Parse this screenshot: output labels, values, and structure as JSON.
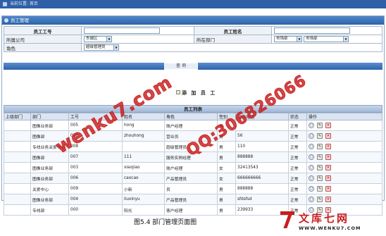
{
  "topbar": {
    "location": "当前位置: 首页"
  },
  "panel": {
    "title": "员工管理"
  },
  "form": {
    "emp_no_label": "员工工号",
    "emp_name_label": "员工姓名",
    "company_label": "所属公司",
    "company_value": "东城区",
    "dept_label": "所在部门",
    "dept_value1": "市场部",
    "dept_value2": "市场部",
    "role_label": "角色",
    "role_value": "超级管理员"
  },
  "search_button": "查  询",
  "add_employee": "添 加 员 工",
  "list_title": "员工列表",
  "table": {
    "headers": [
      "上级部门",
      "部门",
      "工号",
      "姓名",
      "角色",
      "性别",
      "工作电话",
      "状态",
      "操作"
    ],
    "rows": [
      [
        "",
        "图像业务部",
        "005",
        "hong",
        "账户经理",
        "男",
        "",
        "正常"
      ],
      [
        "",
        "图像部",
        "002",
        "zhouhong",
        "营业员",
        "男",
        "56",
        "正常"
      ],
      [
        "",
        "专线业务关爱中心",
        "008",
        "",
        "超级管理员",
        "男",
        "110",
        "正常"
      ],
      [
        "",
        "图像部",
        "007",
        "111",
        "服务实例经理",
        "男",
        "888888",
        "正常"
      ],
      [
        "",
        "图像业务部",
        "003",
        "xiaojiao",
        "账户经理",
        "女",
        "32413543",
        "正常"
      ],
      [
        "",
        "图像业务部",
        "006",
        "caocao",
        "产品管理员",
        "女",
        "666666666",
        "正常"
      ],
      [
        "",
        "关爱中心",
        "009",
        "小新",
        "员",
        "男",
        "888888",
        "正常"
      ],
      [
        "",
        "图像业务部",
        "004",
        "liuxinyu",
        "产品管理员",
        "男",
        "sfdsfsd",
        "正常"
      ],
      [
        "",
        "专线部",
        "000",
        "阳光",
        "客户经理",
        "男",
        "239933",
        "正常"
      ]
    ]
  },
  "ops": {
    "view_icon": "magnifier-icon",
    "edit_icon": "pencil-icon",
    "delete_icon": "delete-icon"
  },
  "caption": "图5.4  部门管理页面图",
  "watermark": {
    "left": "wenku7.com",
    "right": "QQ:306826066"
  },
  "logo": {
    "name": "文库七网",
    "site": "WWW.WENKU7.COM"
  },
  "colors": {
    "header_blue": "#2d62a8",
    "watermark_red": "#c81e1e"
  }
}
